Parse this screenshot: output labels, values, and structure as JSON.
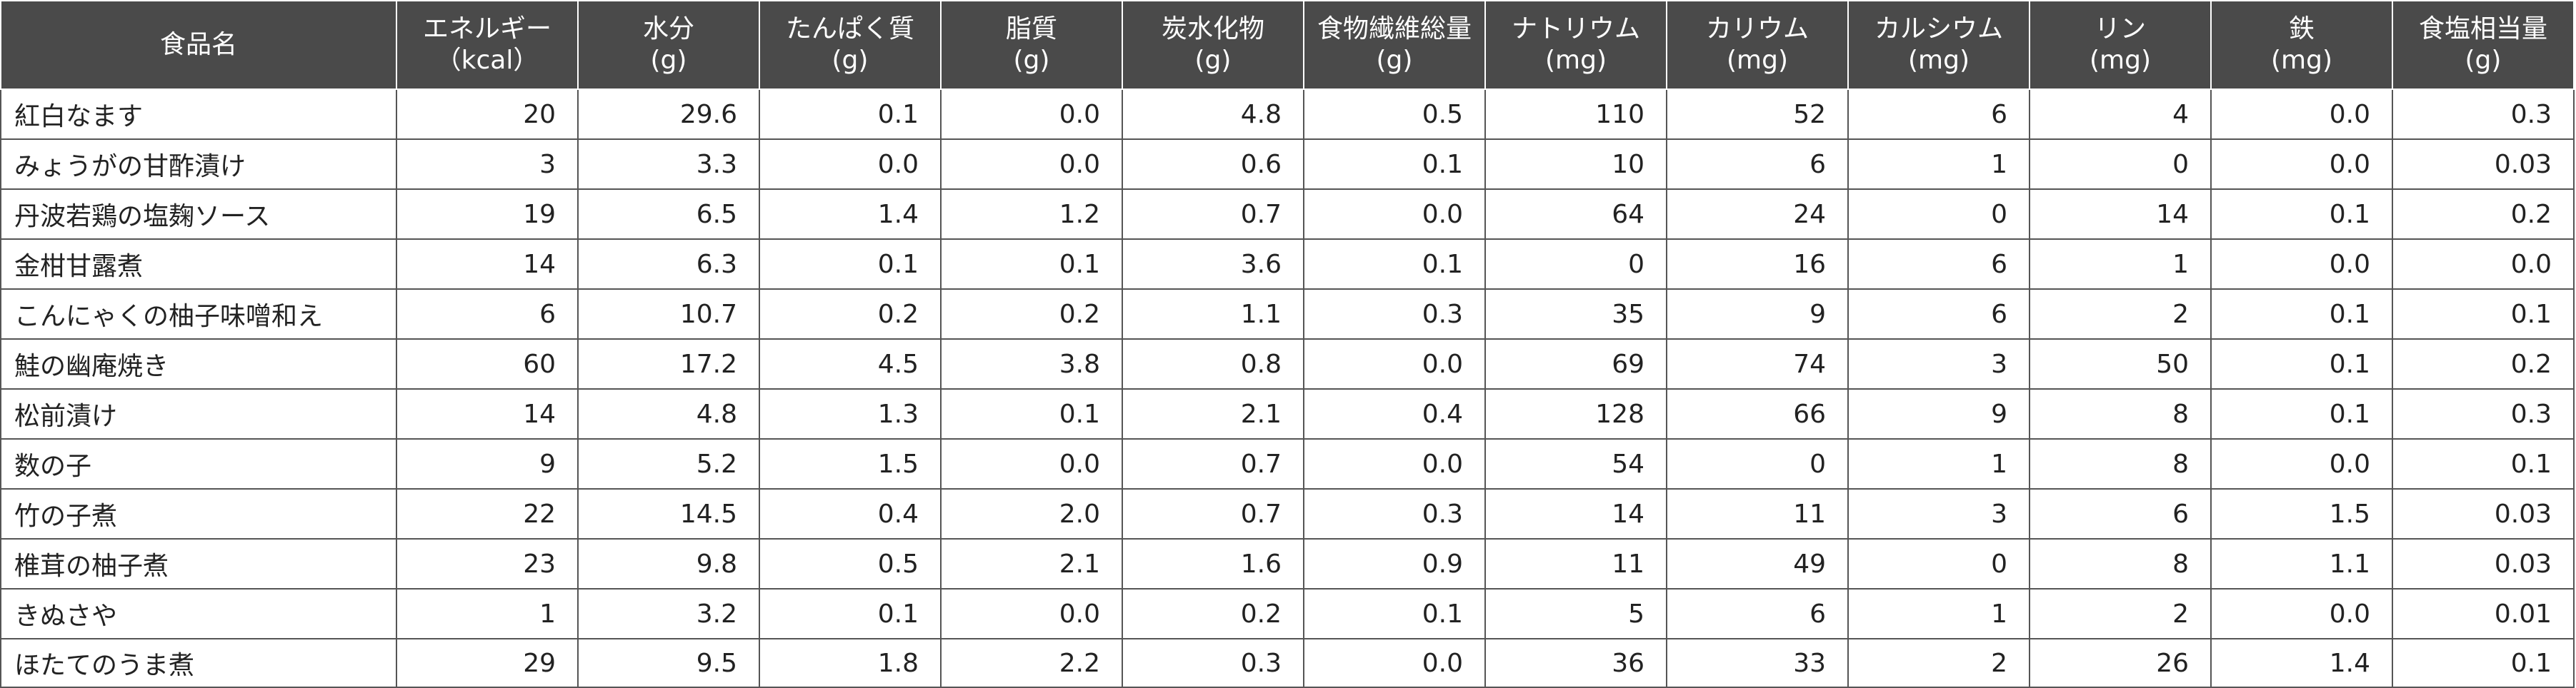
{
  "headers": [
    {
      "l1": "食品名",
      "l2": ""
    },
    {
      "l1": "エネルギー",
      "l2": "（kcal）"
    },
    {
      "l1": "水分",
      "l2": "(g)"
    },
    {
      "l1": "たんぱく質",
      "l2": "(g)"
    },
    {
      "l1": "脂質",
      "l2": "(g)"
    },
    {
      "l1": "炭水化物",
      "l2": "(g)"
    },
    {
      "l1": "食物繊維総量",
      "l2": "(g)"
    },
    {
      "l1": "ナトリウム",
      "l2": "(mg)"
    },
    {
      "l1": "カリウム",
      "l2": "(mg)"
    },
    {
      "l1": "カルシウム",
      "l2": "(mg)"
    },
    {
      "l1": "リン",
      "l2": "(mg)"
    },
    {
      "l1": "鉄",
      "l2": "(mg)"
    },
    {
      "l1": "食塩相当量",
      "l2": "(g)"
    }
  ],
  "rows": [
    [
      "紅白なます",
      "20",
      "29.6",
      "0.1",
      "0.0",
      "4.8",
      "0.5",
      "110",
      "52",
      "6",
      "4",
      "0.0",
      "0.3"
    ],
    [
      "みょうがの甘酢漬け",
      "3",
      "3.3",
      "0.0",
      "0.0",
      "0.6",
      "0.1",
      "10",
      "6",
      "1",
      "0",
      "0.0",
      "0.03"
    ],
    [
      "丹波若鶏の塩麹ソース",
      "19",
      "6.5",
      "1.4",
      "1.2",
      "0.7",
      "0.0",
      "64",
      "24",
      "0",
      "14",
      "0.1",
      "0.2"
    ],
    [
      "金柑甘露煮",
      "14",
      "6.3",
      "0.1",
      "0.1",
      "3.6",
      "0.1",
      "0",
      "16",
      "6",
      "1",
      "0.0",
      "0.0"
    ],
    [
      "こんにゃくの柚子味噌和え",
      "6",
      "10.7",
      "0.2",
      "0.2",
      "1.1",
      "0.3",
      "35",
      "9",
      "6",
      "2",
      "0.1",
      "0.1"
    ],
    [
      "鮭の幽庵焼き",
      "60",
      "17.2",
      "4.5",
      "3.8",
      "0.8",
      "0.0",
      "69",
      "74",
      "3",
      "50",
      "0.1",
      "0.2"
    ],
    [
      "松前漬け",
      "14",
      "4.8",
      "1.3",
      "0.1",
      "2.1",
      "0.4",
      "128",
      "66",
      "9",
      "8",
      "0.1",
      "0.3"
    ],
    [
      "数の子",
      "9",
      "5.2",
      "1.5",
      "0.0",
      "0.7",
      "0.0",
      "54",
      "0",
      "1",
      "8",
      "0.0",
      "0.1"
    ],
    [
      "竹の子煮",
      "22",
      "14.5",
      "0.4",
      "2.0",
      "0.7",
      "0.3",
      "14",
      "11",
      "3",
      "6",
      "1.5",
      "0.03"
    ],
    [
      "椎茸の柚子煮",
      "23",
      "9.8",
      "0.5",
      "2.1",
      "1.6",
      "0.9",
      "11",
      "49",
      "0",
      "8",
      "1.1",
      "0.03"
    ],
    [
      "きぬさや",
      "1",
      "3.2",
      "0.1",
      "0.0",
      "0.2",
      "0.1",
      "5",
      "6",
      "1",
      "2",
      "0.0",
      "0.01"
    ],
    [
      "ほたてのうま煮",
      "29",
      "9.5",
      "1.8",
      "2.2",
      "0.3",
      "0.0",
      "36",
      "33",
      "2",
      "26",
      "1.4",
      "0.1"
    ]
  ]
}
